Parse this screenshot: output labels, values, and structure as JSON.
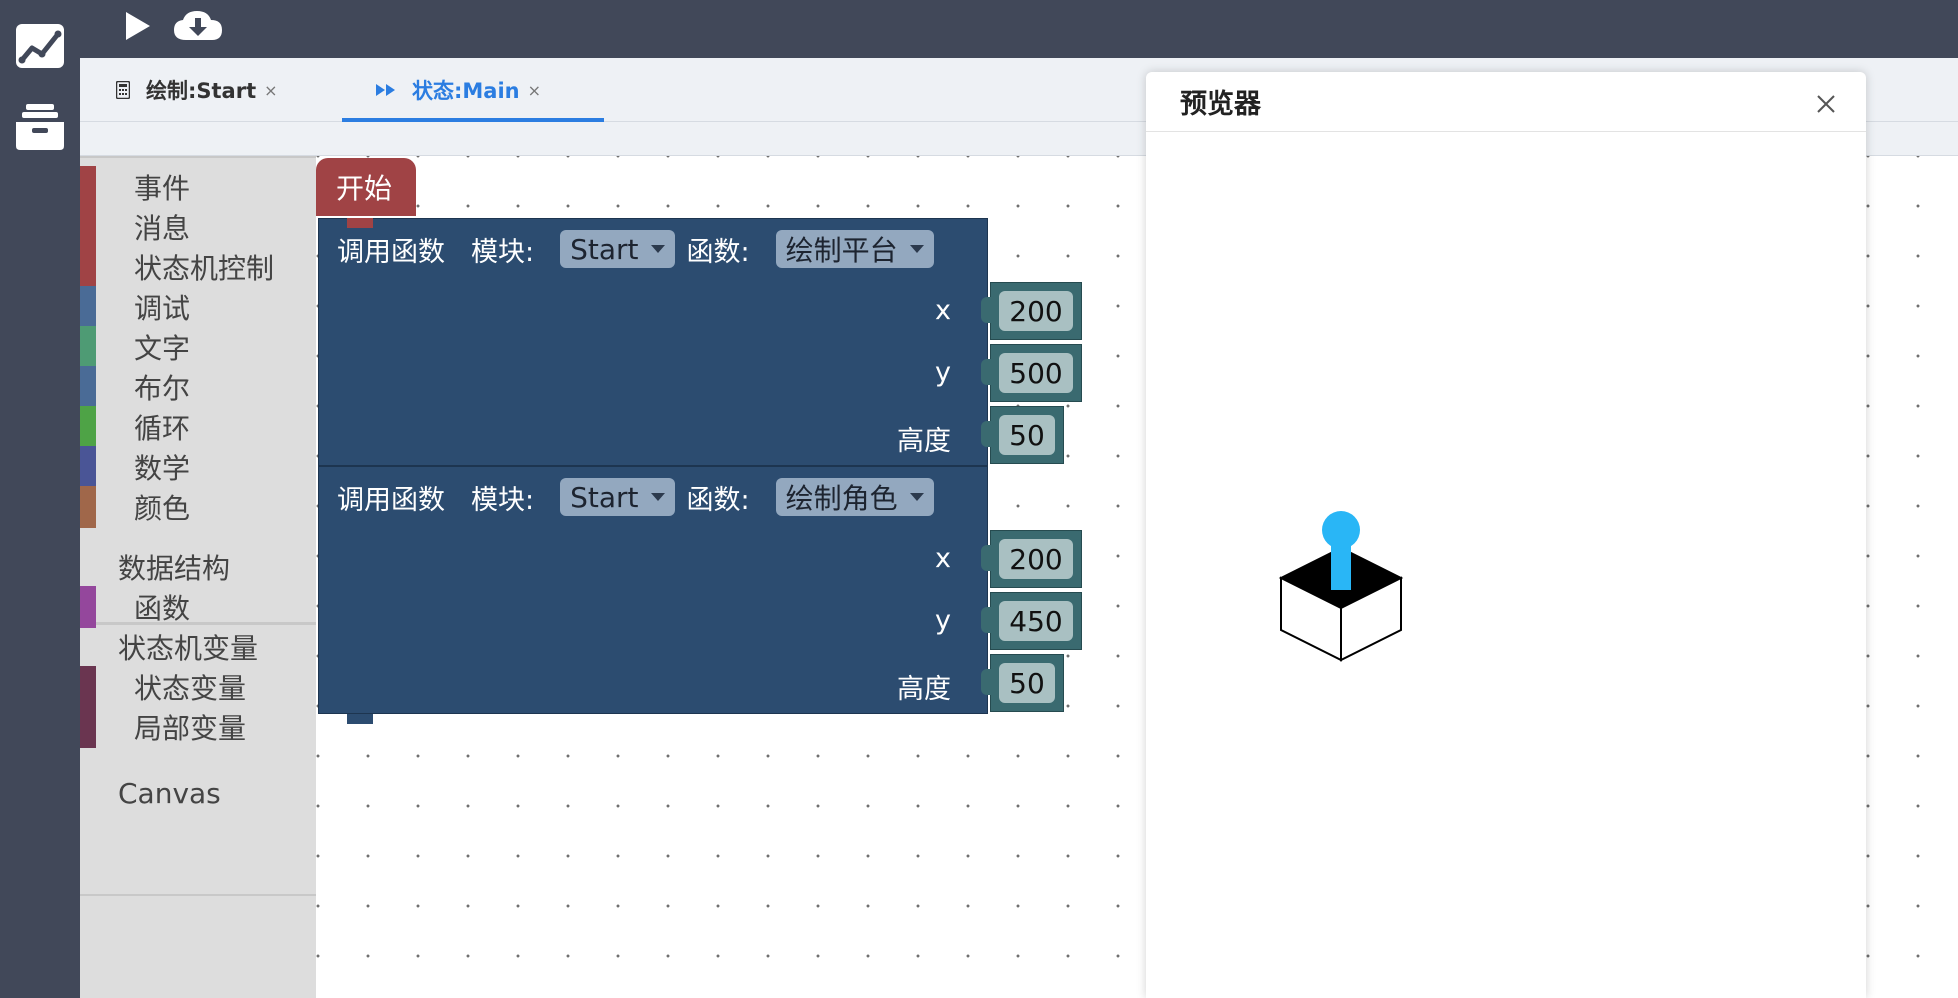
{
  "tabs": [
    {
      "label": "绘制:Start",
      "close": "×"
    },
    {
      "label": "状态:Main",
      "close": "×"
    }
  ],
  "toolbox": {
    "categories": [
      {
        "label": "事件",
        "color": "#a04345"
      },
      {
        "label": "消息",
        "color": "#a04345"
      },
      {
        "label": "状态机控制",
        "color": "#a04345"
      },
      {
        "label": "调试",
        "color": "#4a6b96"
      },
      {
        "label": "文字",
        "color": "#4e9b74"
      },
      {
        "label": "布尔",
        "color": "#4a6b96"
      },
      {
        "label": "循环",
        "color": "#4ea346"
      },
      {
        "label": "数学",
        "color": "#4a5596"
      },
      {
        "label": "颜色",
        "color": "#a0674a"
      }
    ],
    "data_structures": "数据结构",
    "functions": {
      "label": "函数",
      "color": "#94479c"
    },
    "fsm_vars": "状态机变量",
    "state_var": {
      "label": "状态变量",
      "color": "#6a3550"
    },
    "local_var": {
      "label": "局部变量",
      "color": "#6a3550"
    },
    "canvas": "Canvas"
  },
  "blocks": {
    "hat_label": "开始",
    "call1": {
      "call_label": "调用函数",
      "module_label": "模块:",
      "module_value": "Start",
      "func_label": "函数:",
      "func_value": "绘制平台",
      "args": [
        {
          "name": "x",
          "value": "200"
        },
        {
          "name": "y",
          "value": "500"
        },
        {
          "name": "高度",
          "value": "50"
        }
      ]
    },
    "call2": {
      "call_label": "调用函数",
      "module_label": "模块:",
      "module_value": "Start",
      "func_label": "函数:",
      "func_value": "绘制角色",
      "args": [
        {
          "name": "x",
          "value": "200"
        },
        {
          "name": "y",
          "value": "450"
        },
        {
          "name": "高度",
          "value": "50"
        }
      ]
    }
  },
  "preview": {
    "title": "预览器"
  },
  "colors": {
    "rail_bg": "#414859",
    "accent": "#2b7de1",
    "block_bg": "#2c4c70",
    "hat_bg": "#a04345",
    "value_bg": "#3a6a70",
    "sprite_head": "#29b6f6"
  }
}
